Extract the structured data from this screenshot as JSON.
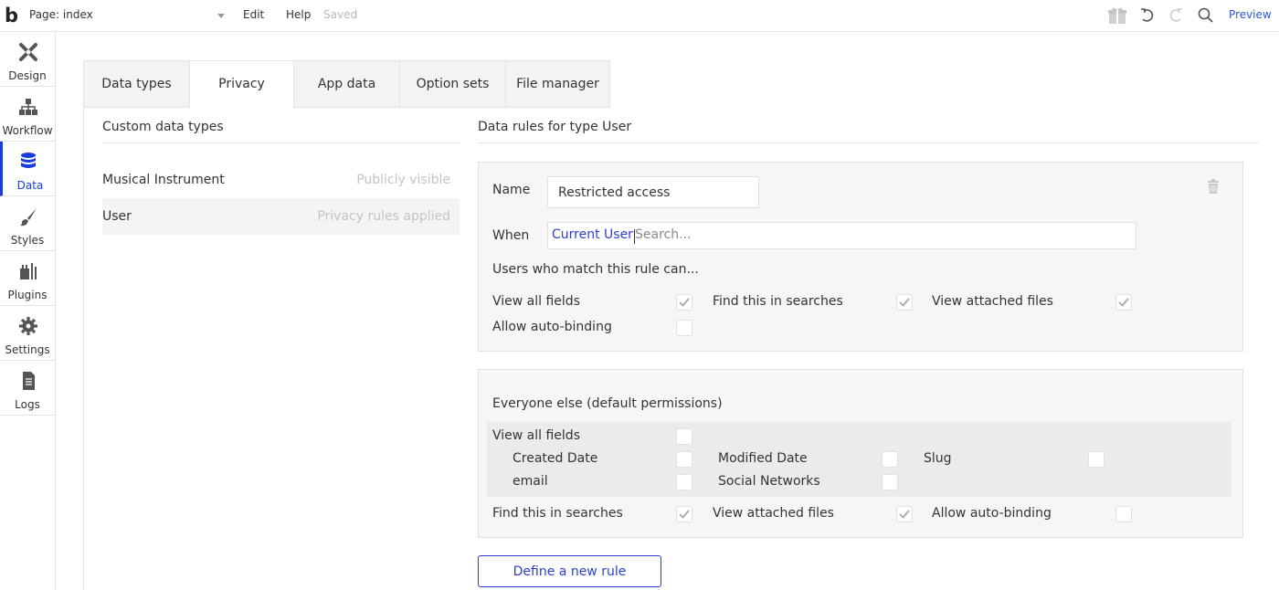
{
  "topbar": {
    "page_label": "Page: index",
    "menu_edit": "Edit",
    "menu_help": "Help",
    "saved": "Saved",
    "preview": "Preview",
    "logo_letter": "b"
  },
  "sidebar": {
    "items": [
      {
        "label": "Design",
        "icon": "design-tools-icon"
      },
      {
        "label": "Workflow",
        "icon": "workflow-tree-icon"
      },
      {
        "label": "Data",
        "icon": "database-icon",
        "active": true
      },
      {
        "label": "Styles",
        "icon": "paintbrush-icon"
      },
      {
        "label": "Plugins",
        "icon": "plugin-icon"
      },
      {
        "label": "Settings",
        "icon": "gear-icon"
      },
      {
        "label": "Logs",
        "icon": "document-icon"
      }
    ]
  },
  "tabs": [
    {
      "label": "Data types"
    },
    {
      "label": "Privacy",
      "active": true
    },
    {
      "label": "App data"
    },
    {
      "label": "Option sets"
    },
    {
      "label": "File manager"
    }
  ],
  "left_panel": {
    "title": "Custom data types",
    "types": [
      {
        "name": "Musical Instrument",
        "status": "Publicly visible"
      },
      {
        "name": "User",
        "status": "Privacy rules applied",
        "selected": true
      }
    ]
  },
  "right_panel": {
    "title": "Data rules for type User",
    "rule": {
      "name_label": "Name",
      "name_value": "Restricted access",
      "when_label": "When",
      "when_chip": "Current User",
      "when_placeholder": "Search...",
      "match_label": "Users who match this rule can...",
      "perms": [
        {
          "label": "View all fields",
          "checked": true
        },
        {
          "label": "Find this in searches",
          "checked": true
        },
        {
          "label": "View attached files",
          "checked": true
        },
        {
          "label": "Allow auto-binding",
          "checked": false
        }
      ]
    },
    "default": {
      "title": "Everyone else (default permissions)",
      "view_all_fields": {
        "label": "View all fields",
        "checked": false
      },
      "fields": [
        {
          "label": "Created Date",
          "checked": false
        },
        {
          "label": "Modified Date",
          "checked": false
        },
        {
          "label": "Slug",
          "checked": false
        },
        {
          "label": "email",
          "checked": false
        },
        {
          "label": "Social Networks",
          "checked": false
        }
      ],
      "perms": [
        {
          "label": "Find this in searches",
          "checked": true
        },
        {
          "label": "View attached files",
          "checked": true
        },
        {
          "label": "Allow auto-binding",
          "checked": false
        }
      ]
    },
    "define_button": "Define a new rule"
  },
  "colors": {
    "accent": "#2b3fd0",
    "sidebar_active": "#1a3de0",
    "panel_bg": "#f6f6f6",
    "muted_text": "#c4c4c4"
  }
}
